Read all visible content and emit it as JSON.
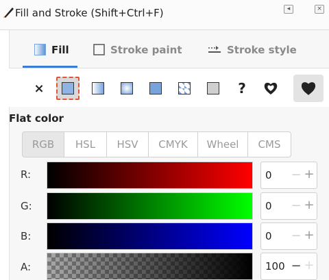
{
  "window": {
    "title": "Fill and Stroke (Shift+Ctrl+F)"
  },
  "tabs": [
    {
      "label": "Fill",
      "active": true
    },
    {
      "label": "Stroke paint",
      "active": false
    },
    {
      "label": "Stroke style",
      "active": false
    }
  ],
  "paint_types": [
    "no-paint",
    "flat-color",
    "linear-gradient",
    "radial-gradient",
    "mesh-gradient",
    "pattern",
    "swatch",
    "unset",
    "evenodd-fill-rule",
    "nonzero-fill-rule"
  ],
  "section_label": "Flat color",
  "color_modes": [
    {
      "label": "RGB",
      "active": true
    },
    {
      "label": "HSL",
      "active": false
    },
    {
      "label": "HSV",
      "active": false
    },
    {
      "label": "CMYK",
      "active": false
    },
    {
      "label": "Wheel",
      "active": false
    },
    {
      "label": "CMS",
      "active": false
    }
  ],
  "channels": [
    {
      "label": "R:",
      "value": "0",
      "color": "#ff0000"
    },
    {
      "label": "G:",
      "value": "0",
      "color": "#00ff00"
    },
    {
      "label": "B:",
      "value": "0",
      "color": "#0000ff"
    },
    {
      "label": "A:",
      "value": "100",
      "color": "#000000"
    }
  ],
  "unset_glyph": "?",
  "no_paint_glyph": "×",
  "spin_minus": "−",
  "spin_plus": "+"
}
